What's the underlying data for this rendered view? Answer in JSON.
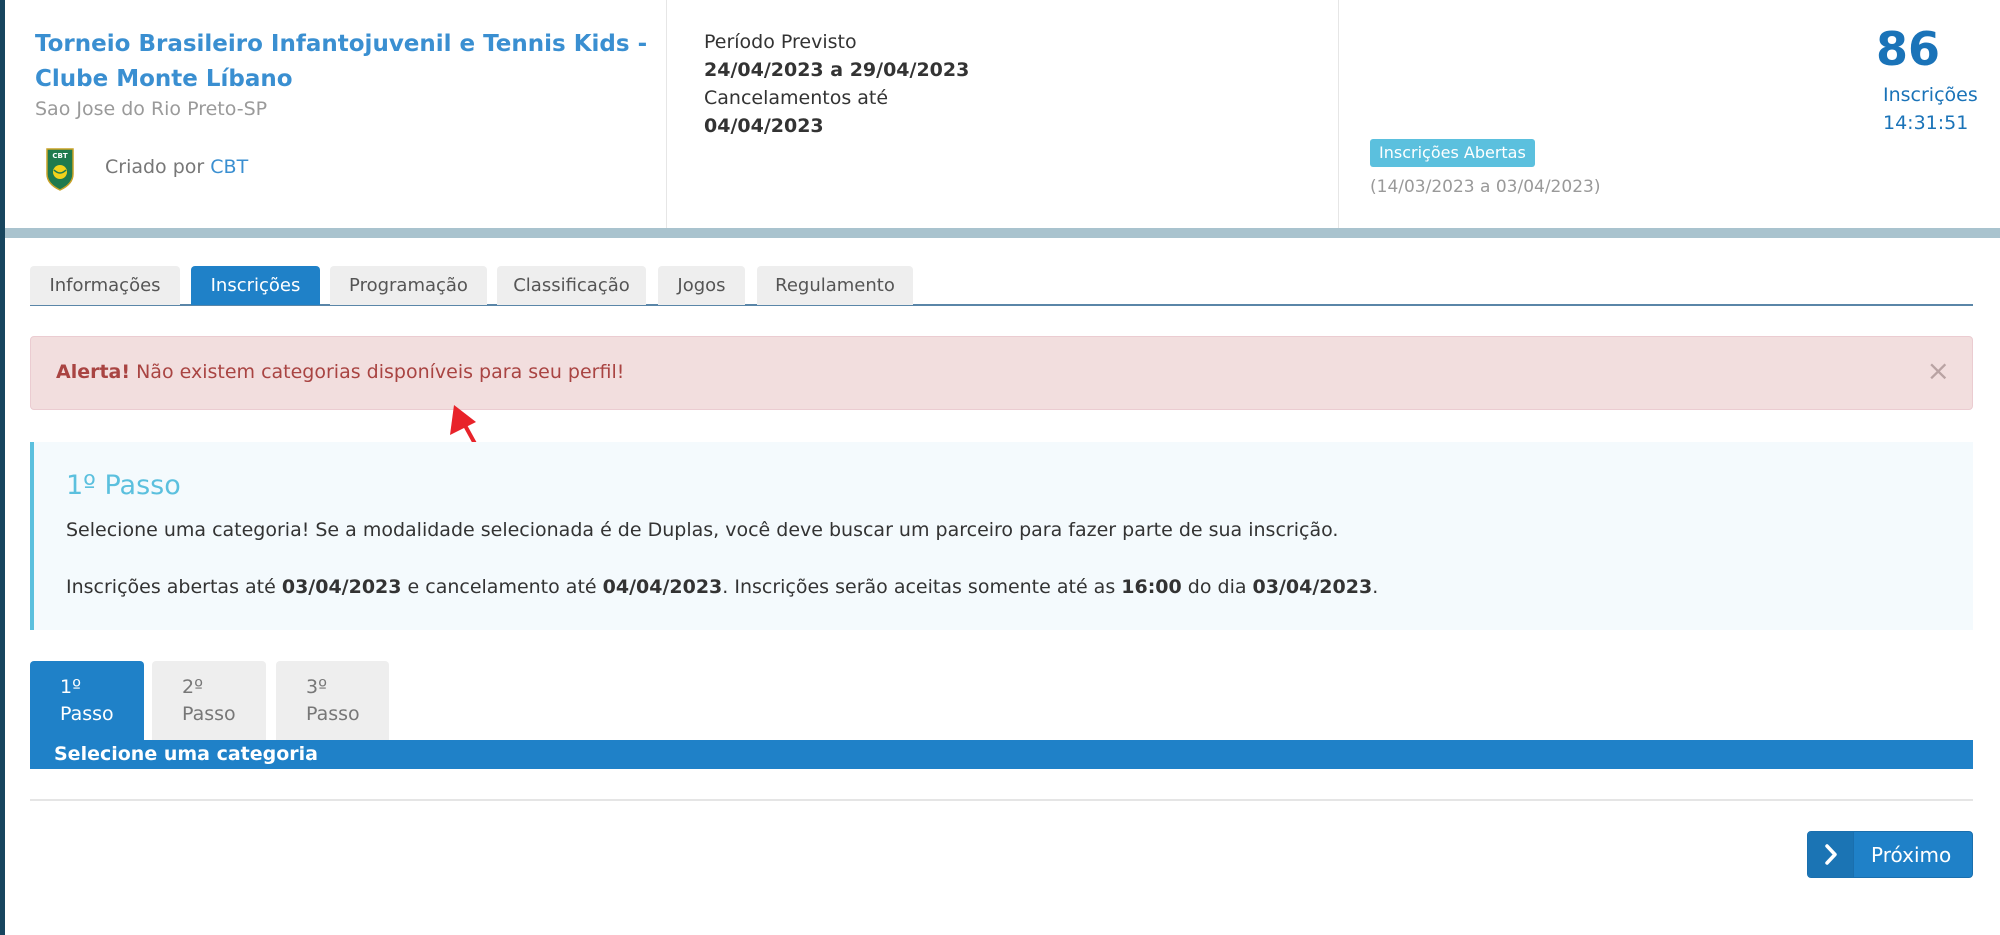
{
  "tournament": {
    "title": "Torneio Brasileiro Infantojuvenil e Tennis Kids - Clube Monte Líbano",
    "city": "Sao Jose do Rio Preto-SP",
    "created_by_label": "Criado por",
    "created_by_link": "CBT",
    "logo_text": "CBT"
  },
  "period": {
    "label": "Período Previsto",
    "dates": "24/04/2023 a 29/04/2023",
    "cancel_label": "Cancelamentos até",
    "cancel_date": "04/04/2023"
  },
  "status": {
    "badge": "Inscrições Abertas",
    "range": "(14/03/2023 a 03/04/2023)"
  },
  "registrations": {
    "count": "86",
    "label": "Inscrições",
    "time": "14:31:51"
  },
  "tabs": [
    {
      "label": "Informações",
      "active": false
    },
    {
      "label": "Inscrições",
      "active": true
    },
    {
      "label": "Programação",
      "active": false
    },
    {
      "label": "Classificação",
      "active": false
    },
    {
      "label": "Jogos",
      "active": false
    },
    {
      "label": "Regulamento",
      "active": false
    }
  ],
  "alert": {
    "strong": "Alerta!",
    "message": "Não existem categorias disponíveis para seu perfil!",
    "close": "×"
  },
  "info": {
    "title": "1º Passo",
    "line1": "Selecione uma categoria! Se a modalidade selecionada é de Duplas, você deve buscar um parceiro para fazer parte de sua inscrição.",
    "line2_a": "Inscrições abertas até ",
    "line2_b": "03/04/2023",
    "line2_c": " e cancelamento até ",
    "line2_d": "04/04/2023",
    "line2_e": ". Inscrições serão aceitas somente até as ",
    "line2_f": "16:00",
    "line2_g": " do dia ",
    "line2_h": "03/04/2023",
    "line2_i": "."
  },
  "steps": [
    {
      "num": "1º",
      "word": "Passo",
      "active": true
    },
    {
      "num": "2º",
      "word": "Passo",
      "active": false
    },
    {
      "num": "3º",
      "word": "Passo",
      "active": false
    }
  ],
  "step_bar": "Selecione uma categoria",
  "next_button": "Próximo",
  "colors": {
    "primary": "#1f81c8",
    "title_link": "#3a8fd1",
    "alert_bg": "#f2dede",
    "alert_text": "#a94442",
    "info_accent": "#5bc0de",
    "header_bar": "#a9c3ce",
    "arrow": "#e8232a"
  }
}
